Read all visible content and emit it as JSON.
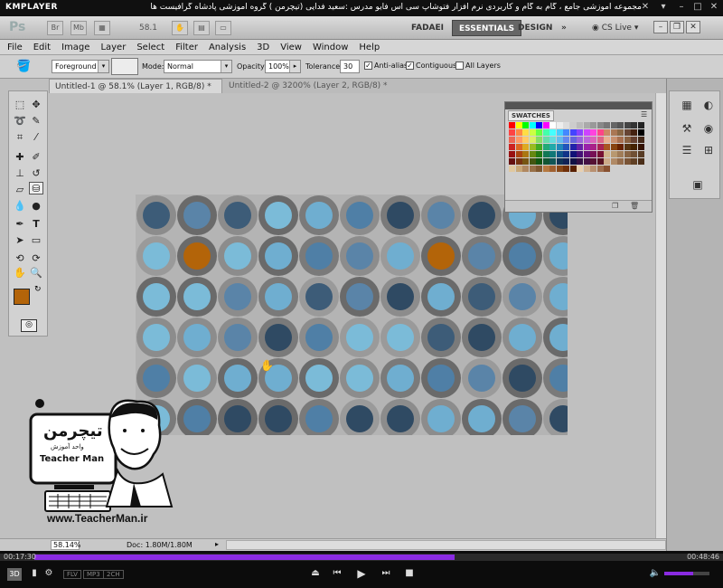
{
  "player": {
    "logo": "KMPLAYER",
    "caption": "مجموعه آموزشی جامع ، گام به گام و کاربردی نرم افزار فتوشاپ سی اس فایو  مدرس :سعید فدایی (تیچرمن ) گروه آموزشی پادشاه گرافیست ها",
    "time_elapsed": "00:17:30",
    "time_total": "00:48:46",
    "progress_fraction": 0.58,
    "volume_fraction": 0.64,
    "badge_3d": "3D",
    "formats": [
      "FLV",
      "MP3",
      "2CH"
    ]
  },
  "app": {
    "logo": "Ps",
    "mini_btns": [
      "Br",
      "Mb"
    ],
    "zoom": "58.1",
    "workspaces": [
      "FADAEI",
      "ESSENTIALS",
      "DESIGN"
    ],
    "active_workspace": "ESSENTIALS",
    "cs_live": "CS Live"
  },
  "menu": [
    "File",
    "Edit",
    "Image",
    "Layer",
    "Select",
    "Filter",
    "Analysis",
    "3D",
    "View",
    "Window",
    "Help"
  ],
  "options": {
    "fill_source": "Foreground",
    "mode_label": "Mode:",
    "mode_value": "Normal",
    "opacity_label": "Opacity:",
    "opacity_value": "100%",
    "tolerance_label": "Tolerance:",
    "tolerance_value": "30",
    "antialias": "Anti-alias",
    "contiguous": "Contiguous",
    "all_layers": "All Layers"
  },
  "tabs": [
    {
      "label": "Untitled-1 @ 58.1% (Layer 1, RGB/8) *"
    },
    {
      "label": "Untitled-2 @ 3200% (Layer 2, RGB/8) *"
    }
  ],
  "colors": {
    "foreground": "#b36409",
    "background": "#ffffff",
    "dot_fill_alt": "#b36409"
  },
  "swatches": {
    "title": "SWATCHES"
  },
  "status": {
    "zoom": "58.14%",
    "doc": "Doc: 1.80M/1.80M"
  },
  "watermark": {
    "brand_fa": "تیچرمن",
    "subtitle_fa": "واحد آموزش",
    "brand_en": "Teacher Man",
    "url": "www.TeacherMan.ir"
  }
}
